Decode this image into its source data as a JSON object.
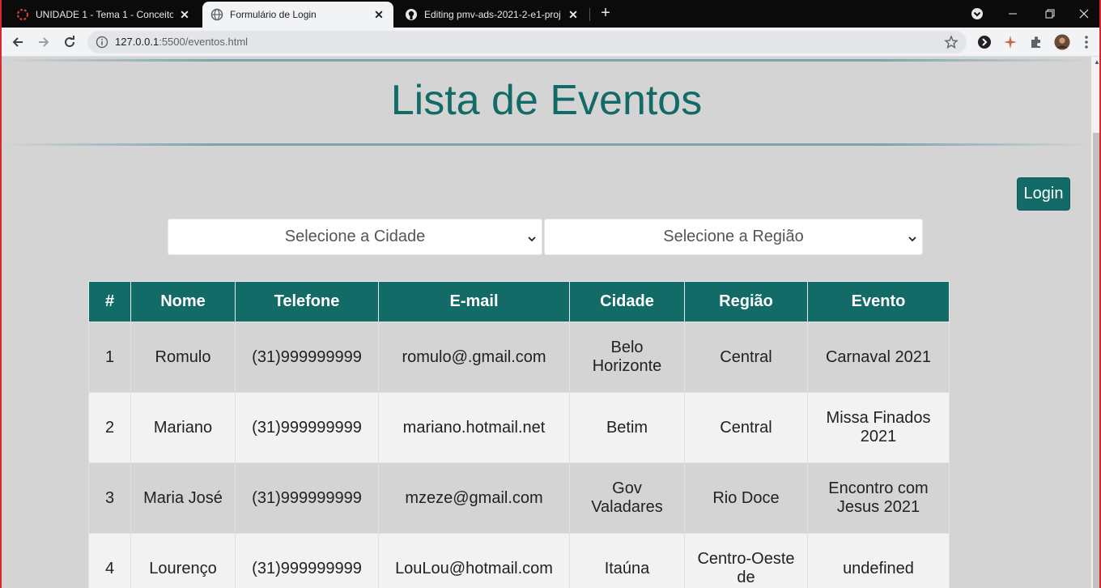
{
  "browser": {
    "tabs": [
      {
        "title": "UNIDADE 1 - Tema 1 - Conceitos",
        "active": false
      },
      {
        "title": "Formulário de Login",
        "active": true
      },
      {
        "title": "Editing pmv-ads-2021-2-e1-proj",
        "active": false
      }
    ],
    "url_host": "127.0.0.1",
    "url_rest": ":5500/eventos.html"
  },
  "page": {
    "title": "Lista de Eventos",
    "login_label": "Login",
    "city_select": "Selecione a Cidade",
    "region_select": "Selecione a Região"
  },
  "table": {
    "headers": [
      "#",
      "Nome",
      "Telefone",
      "E-mail",
      "Cidade",
      "Região",
      "Evento"
    ],
    "rows": [
      [
        "1",
        "Romulo",
        "(31)999999999",
        "romulo@.gmail.com",
        "Belo Horizonte",
        "Central",
        "Carnaval 2021"
      ],
      [
        "2",
        "Mariano",
        "(31)999999999",
        "mariano.hotmail.net",
        "Betim",
        "Central",
        "Missa Finados 2021"
      ],
      [
        "3",
        "Maria José",
        "(31)999999999",
        "mzeze@gmail.com",
        "Gov Valadares",
        "Rio Doce",
        "Encontro com Jesus 2021"
      ],
      [
        "4",
        "Lourenço",
        "(31)999999999",
        "LouLou@hotmail.com",
        "Itaúna",
        "Centro-Oeste de",
        "undefined"
      ]
    ]
  },
  "colors": {
    "accent": "#136b67",
    "page_bg": "#d4d4d4"
  }
}
